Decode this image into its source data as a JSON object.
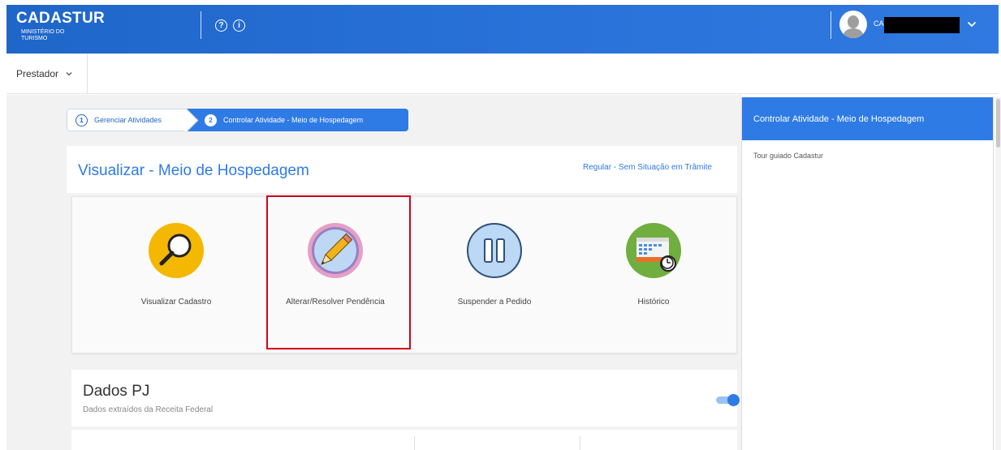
{
  "header": {
    "brand_name": "CADASTUR",
    "brand_sub": "MINISTÉRIO DO TURISMO",
    "help_icon_glyph": "?",
    "info_icon_glyph": "i",
    "user_name_visible": "CA",
    "colors": {
      "primary": "#2f7be5",
      "header": "#1f66c9"
    }
  },
  "profile": {
    "selected": "Prestador"
  },
  "stepper": {
    "steps": [
      {
        "number": "1",
        "label": "Gerenciar Atividades"
      },
      {
        "number": "2",
        "label": "Controlar Atividade - Meio de Hospedagem"
      }
    ]
  },
  "page": {
    "title": "Visualizar - Meio de Hospedagem",
    "status": "Regular - Sem Situação em Trâmite"
  },
  "actions": [
    {
      "label": "Visualizar Cadastro",
      "icon": "magnifier-icon"
    },
    {
      "label": "Alterar/Resolver Pendência",
      "icon": "pencil-icon"
    },
    {
      "label": "Suspender a Pedido",
      "icon": "pause-icon"
    },
    {
      "label": "Histórico",
      "icon": "calendar-clock-icon"
    }
  ],
  "dados_pj": {
    "title": "Dados PJ",
    "subtitle": "Dados extraídos da Receita Federal"
  },
  "right_panel": {
    "heading": "Controlar Atividade - Meio de Hospedagem",
    "tour_link": "Tour guiado Cadastur"
  }
}
